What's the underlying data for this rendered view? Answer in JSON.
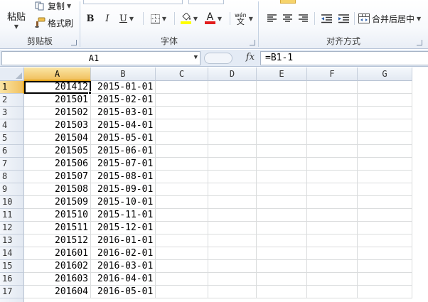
{
  "ribbon": {
    "clipboard": {
      "group_label": "剪贴板",
      "paste_label": "粘贴",
      "copy_label": "复制",
      "format_painter_label": "格式刷"
    },
    "font": {
      "group_label": "字体",
      "bold_label": "B",
      "italic_label": "I",
      "underline_label": "U",
      "font_color_letter": "A",
      "phonetic_label": "wén",
      "phonetic_glyph": "文"
    },
    "alignment": {
      "group_label": "对齐方式",
      "merge_center_label": "合并后居中"
    },
    "colors": {
      "fill_swatch": "#ffff00",
      "font_color_swatch": "#e21d1d"
    }
  },
  "formula_bar": {
    "name_box": "A1",
    "fx_label": "fx",
    "formula": "=B1-1"
  },
  "sheet": {
    "columns": [
      "A",
      "B",
      "C",
      "D",
      "E",
      "F",
      "G"
    ],
    "active_cell": "A1",
    "rows": [
      {
        "row": "1",
        "a": "201412",
        "b": "2015-01-01"
      },
      {
        "row": "2",
        "a": "201501",
        "b": "2015-02-01"
      },
      {
        "row": "3",
        "a": "201502",
        "b": "2015-03-01"
      },
      {
        "row": "4",
        "a": "201503",
        "b": "2015-04-01"
      },
      {
        "row": "5",
        "a": "201504",
        "b": "2015-05-01"
      },
      {
        "row": "6",
        "a": "201505",
        "b": "2015-06-01"
      },
      {
        "row": "7",
        "a": "201506",
        "b": "2015-07-01"
      },
      {
        "row": "8",
        "a": "201507",
        "b": "2015-08-01"
      },
      {
        "row": "9",
        "a": "201508",
        "b": "2015-09-01"
      },
      {
        "row": "10",
        "a": "201509",
        "b": "2015-10-01"
      },
      {
        "row": "11",
        "a": "201510",
        "b": "2015-11-01"
      },
      {
        "row": "12",
        "a": "201511",
        "b": "2015-12-01"
      },
      {
        "row": "13",
        "a": "201512",
        "b": "2016-01-01"
      },
      {
        "row": "14",
        "a": "201601",
        "b": "2016-02-01"
      },
      {
        "row": "15",
        "a": "201602",
        "b": "2016-03-01"
      },
      {
        "row": "16",
        "a": "201603",
        "b": "2016-04-01"
      },
      {
        "row": "17",
        "a": "201604",
        "b": "2016-05-01"
      }
    ]
  }
}
